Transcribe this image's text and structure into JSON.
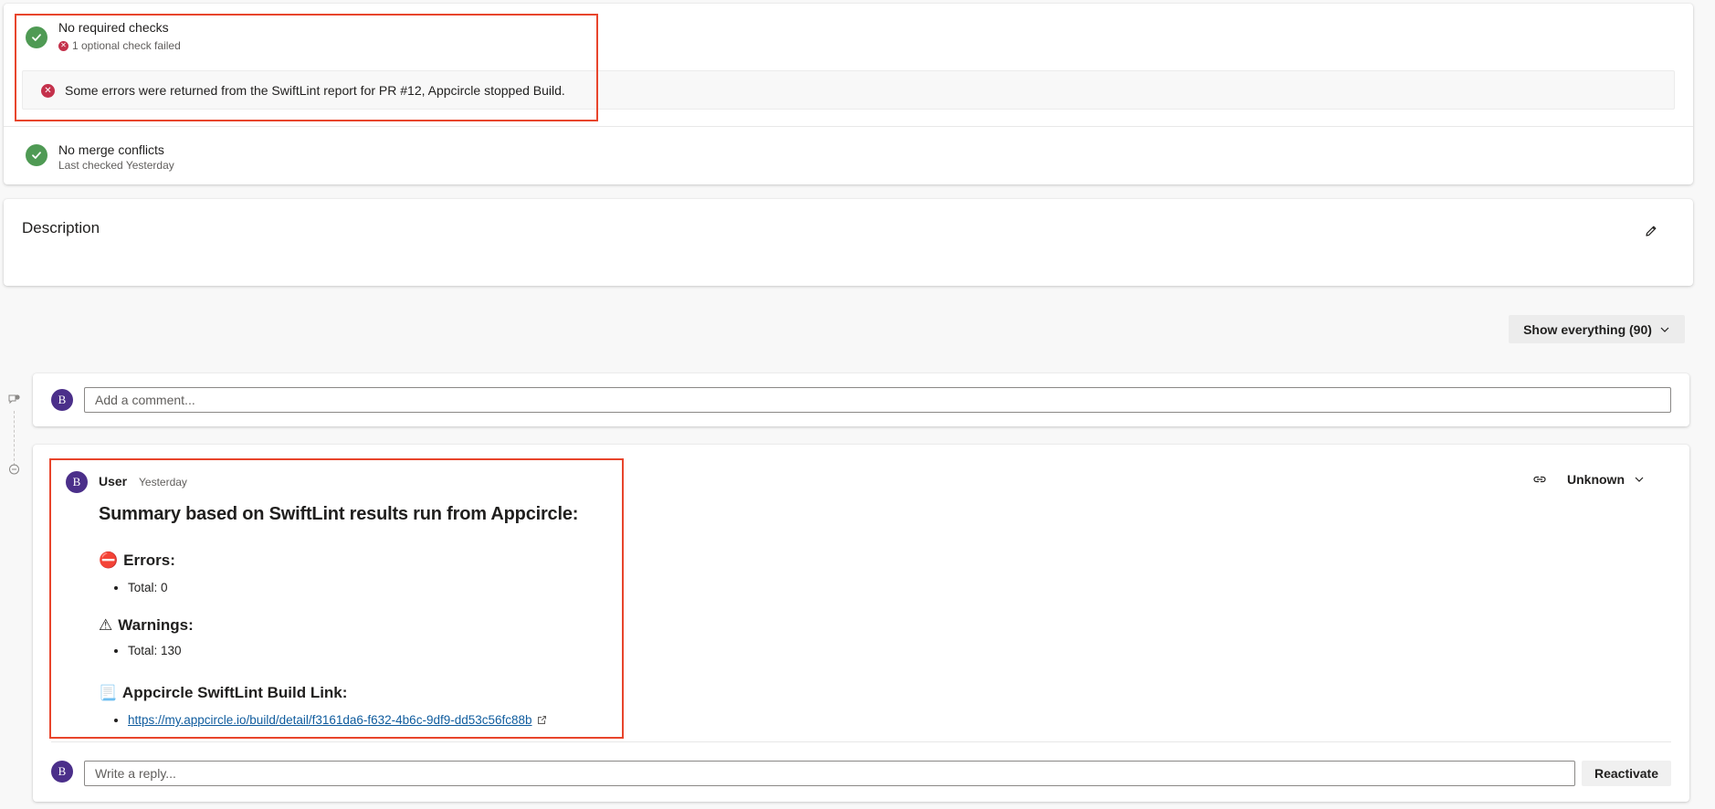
{
  "checks": {
    "required_title": "No required checks",
    "optional_failed": "1 optional check failed",
    "error_message": "Some errors were returned from the SwiftLint report for PR #12, Appcircle stopped Build.",
    "merge_title": "No merge conflicts",
    "merge_subtitle": "Last checked Yesterday"
  },
  "description": {
    "title": "Description"
  },
  "filter": {
    "label": "Show everything (90)"
  },
  "comment_box": {
    "avatar_initial": "B",
    "placeholder": "Add a comment..."
  },
  "thread": {
    "author_initial": "B",
    "author": "User",
    "time": "Yesterday",
    "status": "Unknown",
    "summary_heading": "Summary based on SwiftLint results run from Appcircle:",
    "errors_emoji": "⛔",
    "errors_heading": "Errors:",
    "errors_total": "Total: 0",
    "warnings_emoji": "⚠",
    "warnings_heading": "Warnings:",
    "warnings_total": "Total: 130",
    "link_emoji": "📃",
    "link_heading": "Appcircle SwiftLint Build Link:",
    "build_link": "https://my.appcircle.io/build/detail/f3161da6-f632-4b6c-9df9-dd53c56fc88b",
    "reply_initial": "B",
    "reply_placeholder": "Write a reply...",
    "reactivate_label": "Reactivate"
  },
  "colors": {
    "success": "#4f9a54",
    "error": "#c4314b",
    "highlight": "#e8452c",
    "avatar": "#4b2f8a",
    "link": "#0f5c9e"
  }
}
